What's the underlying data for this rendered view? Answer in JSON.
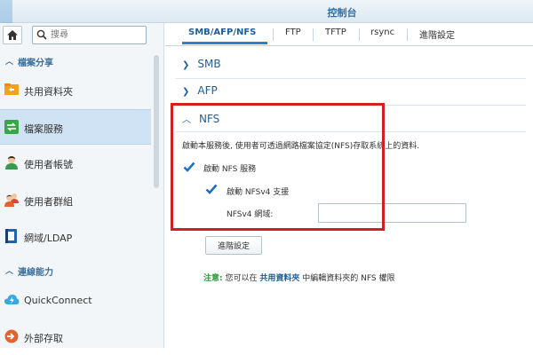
{
  "window": {
    "title": "控制台"
  },
  "sidebar": {
    "search": {
      "placeholder": "搜尋"
    },
    "sections": [
      {
        "label": "檔案分享"
      },
      {
        "label": "連線能力"
      }
    ],
    "items": [
      {
        "label": "共用資料夾",
        "icon": "shared-folder-icon"
      },
      {
        "label": "檔案服務",
        "icon": "file-services-icon",
        "active": true
      },
      {
        "label": "使用者帳號",
        "icon": "user-icon"
      },
      {
        "label": "使用者群組",
        "icon": "group-icon"
      },
      {
        "label": "網域/LDAP",
        "icon": "domain-ldap-icon"
      },
      {
        "label": "QuickConnect",
        "icon": "quickconnect-icon"
      },
      {
        "label": "外部存取",
        "icon": "external-access-icon"
      }
    ]
  },
  "tabs": [
    {
      "label": "SMB/AFP/NFS",
      "active": true
    },
    {
      "label": "FTP"
    },
    {
      "label": "TFTP"
    },
    {
      "label": "rsync"
    },
    {
      "label": "進階設定"
    }
  ],
  "panels": {
    "smb": {
      "label": "SMB",
      "expanded": false
    },
    "afp": {
      "label": "AFP",
      "expanded": false
    },
    "nfs": {
      "label": "NFS",
      "expanded": true,
      "description": "啟動本服務後, 使用者可透過網路檔案協定(NFS)存取系統上的資料.",
      "enable_nfs": {
        "label": "啟動 NFS 服務",
        "checked": true
      },
      "enable_nfsv4": {
        "label": "啟動 NFSv4 支援",
        "checked": true
      },
      "nfsv4_domain": {
        "label": "NFSv4 網域:",
        "value": ""
      },
      "advanced_button": "進階設定",
      "note": {
        "prefix": "注意:",
        "text_before": "您可以在",
        "link": "共用資料夾",
        "text_after": "中編輯資料夾的 NFS 權限"
      }
    }
  },
  "colors": {
    "accent": "#2a7fd0",
    "highlight_box": "#d0201f",
    "note_green": "#2d9a3c"
  }
}
